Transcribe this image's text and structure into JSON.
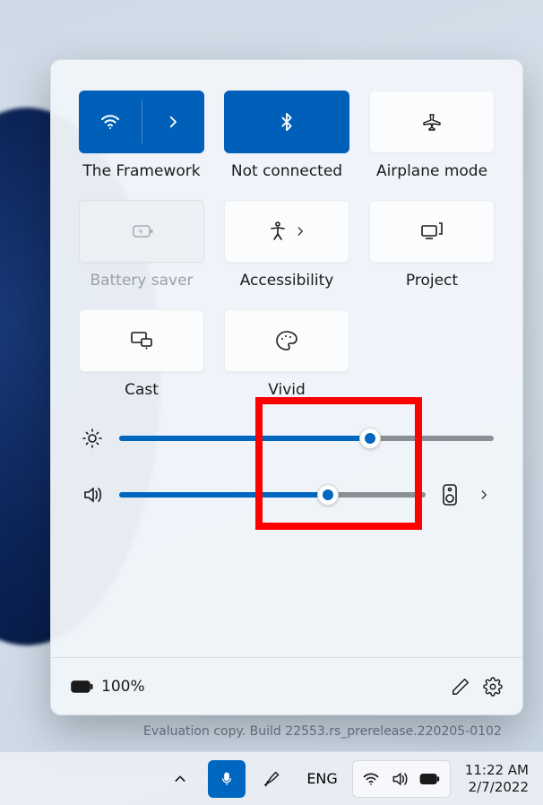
{
  "tiles": {
    "wifi": {
      "label": "The Framework",
      "active": true
    },
    "bluetooth": {
      "label": "Not connected",
      "active": true
    },
    "airplane": {
      "label": "Airplane mode",
      "active": false
    },
    "battery_saver": {
      "label": "Battery saver",
      "disabled": true
    },
    "accessibility": {
      "label": "Accessibility",
      "has_chevron": true
    },
    "project": {
      "label": "Project"
    },
    "cast": {
      "label": "Cast"
    },
    "vivid": {
      "label": "Vivid",
      "highlighted": true
    }
  },
  "sliders": {
    "brightness": {
      "percent": 67
    },
    "volume": {
      "percent": 68
    }
  },
  "footer": {
    "battery_text": "100%"
  },
  "watermark": "Evaluation copy. Build 22553.rs_prerelease.220205-0102",
  "taskbar": {
    "lang": "ENG",
    "time": "11:22 AM",
    "date": "2/7/2022"
  }
}
